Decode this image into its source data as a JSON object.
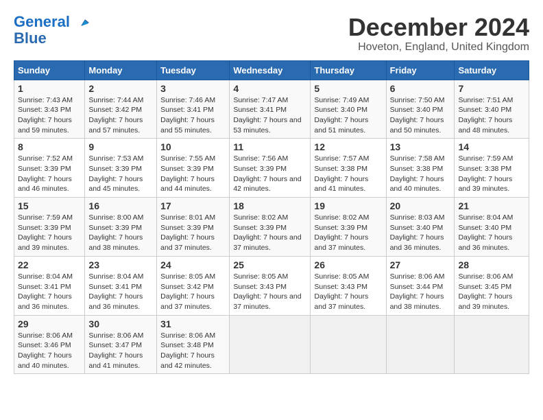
{
  "header": {
    "logo_line1": "General",
    "logo_line2": "Blue",
    "month": "December 2024",
    "location": "Hoveton, England, United Kingdom"
  },
  "weekdays": [
    "Sunday",
    "Monday",
    "Tuesday",
    "Wednesday",
    "Thursday",
    "Friday",
    "Saturday"
  ],
  "weeks": [
    [
      {
        "day": "1",
        "sunrise": "7:43 AM",
        "sunset": "3:43 PM",
        "daylight": "7 hours and 59 minutes."
      },
      {
        "day": "2",
        "sunrise": "7:44 AM",
        "sunset": "3:42 PM",
        "daylight": "7 hours and 57 minutes."
      },
      {
        "day": "3",
        "sunrise": "7:46 AM",
        "sunset": "3:41 PM",
        "daylight": "7 hours and 55 minutes."
      },
      {
        "day": "4",
        "sunrise": "7:47 AM",
        "sunset": "3:41 PM",
        "daylight": "7 hours and 53 minutes."
      },
      {
        "day": "5",
        "sunrise": "7:49 AM",
        "sunset": "3:40 PM",
        "daylight": "7 hours and 51 minutes."
      },
      {
        "day": "6",
        "sunrise": "7:50 AM",
        "sunset": "3:40 PM",
        "daylight": "7 hours and 50 minutes."
      },
      {
        "day": "7",
        "sunrise": "7:51 AM",
        "sunset": "3:40 PM",
        "daylight": "7 hours and 48 minutes."
      }
    ],
    [
      {
        "day": "8",
        "sunrise": "7:52 AM",
        "sunset": "3:39 PM",
        "daylight": "7 hours and 46 minutes."
      },
      {
        "day": "9",
        "sunrise": "7:53 AM",
        "sunset": "3:39 PM",
        "daylight": "7 hours and 45 minutes."
      },
      {
        "day": "10",
        "sunrise": "7:55 AM",
        "sunset": "3:39 PM",
        "daylight": "7 hours and 44 minutes."
      },
      {
        "day": "11",
        "sunrise": "7:56 AM",
        "sunset": "3:39 PM",
        "daylight": "7 hours and 42 minutes."
      },
      {
        "day": "12",
        "sunrise": "7:57 AM",
        "sunset": "3:38 PM",
        "daylight": "7 hours and 41 minutes."
      },
      {
        "day": "13",
        "sunrise": "7:58 AM",
        "sunset": "3:38 PM",
        "daylight": "7 hours and 40 minutes."
      },
      {
        "day": "14",
        "sunrise": "7:59 AM",
        "sunset": "3:38 PM",
        "daylight": "7 hours and 39 minutes."
      }
    ],
    [
      {
        "day": "15",
        "sunrise": "7:59 AM",
        "sunset": "3:39 PM",
        "daylight": "7 hours and 39 minutes."
      },
      {
        "day": "16",
        "sunrise": "8:00 AM",
        "sunset": "3:39 PM",
        "daylight": "7 hours and 38 minutes."
      },
      {
        "day": "17",
        "sunrise": "8:01 AM",
        "sunset": "3:39 PM",
        "daylight": "7 hours and 37 minutes."
      },
      {
        "day": "18",
        "sunrise": "8:02 AM",
        "sunset": "3:39 PM",
        "daylight": "7 hours and 37 minutes."
      },
      {
        "day": "19",
        "sunrise": "8:02 AM",
        "sunset": "3:39 PM",
        "daylight": "7 hours and 37 minutes."
      },
      {
        "day": "20",
        "sunrise": "8:03 AM",
        "sunset": "3:40 PM",
        "daylight": "7 hours and 36 minutes."
      },
      {
        "day": "21",
        "sunrise": "8:04 AM",
        "sunset": "3:40 PM",
        "daylight": "7 hours and 36 minutes."
      }
    ],
    [
      {
        "day": "22",
        "sunrise": "8:04 AM",
        "sunset": "3:41 PM",
        "daylight": "7 hours and 36 minutes."
      },
      {
        "day": "23",
        "sunrise": "8:04 AM",
        "sunset": "3:41 PM",
        "daylight": "7 hours and 36 minutes."
      },
      {
        "day": "24",
        "sunrise": "8:05 AM",
        "sunset": "3:42 PM",
        "daylight": "7 hours and 37 minutes."
      },
      {
        "day": "25",
        "sunrise": "8:05 AM",
        "sunset": "3:43 PM",
        "daylight": "7 hours and 37 minutes."
      },
      {
        "day": "26",
        "sunrise": "8:05 AM",
        "sunset": "3:43 PM",
        "daylight": "7 hours and 37 minutes."
      },
      {
        "day": "27",
        "sunrise": "8:06 AM",
        "sunset": "3:44 PM",
        "daylight": "7 hours and 38 minutes."
      },
      {
        "day": "28",
        "sunrise": "8:06 AM",
        "sunset": "3:45 PM",
        "daylight": "7 hours and 39 minutes."
      }
    ],
    [
      {
        "day": "29",
        "sunrise": "8:06 AM",
        "sunset": "3:46 PM",
        "daylight": "7 hours and 40 minutes."
      },
      {
        "day": "30",
        "sunrise": "8:06 AM",
        "sunset": "3:47 PM",
        "daylight": "7 hours and 41 minutes."
      },
      {
        "day": "31",
        "sunrise": "8:06 AM",
        "sunset": "3:48 PM",
        "daylight": "7 hours and 42 minutes."
      },
      null,
      null,
      null,
      null
    ]
  ]
}
